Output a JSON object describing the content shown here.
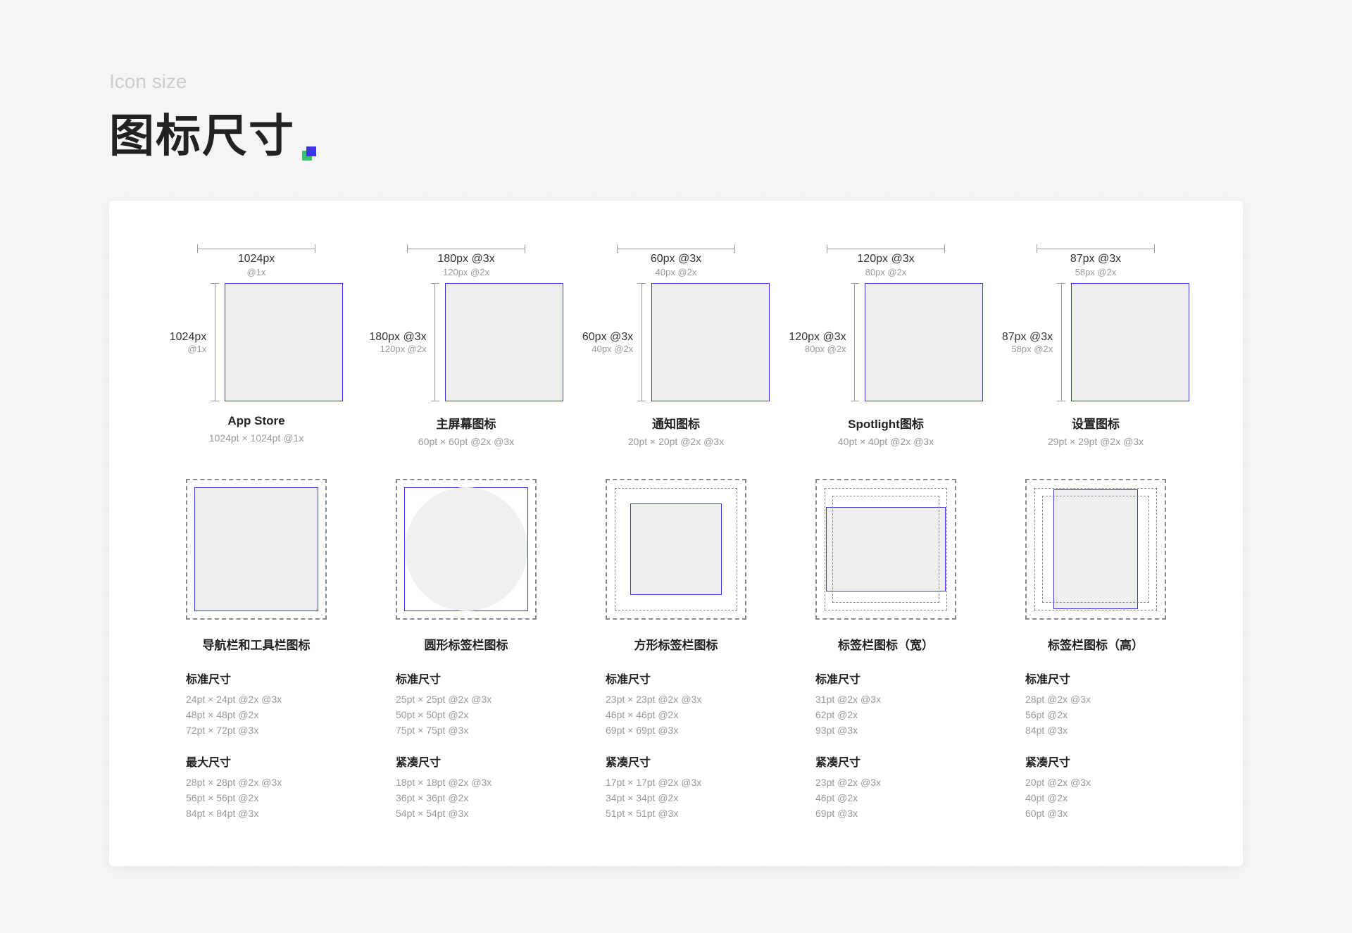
{
  "header": {
    "subtitle": "Icon size",
    "title": "图标尺寸"
  },
  "row1": [
    {
      "topLabel": "1024px",
      "topSub": "@1x",
      "leftLabel": "1024px",
      "leftSub": "@1x",
      "name": "App Store",
      "desc": "1024pt × 1024pt  @1x"
    },
    {
      "topLabel": "180px @3x",
      "topSub": "120px @2x",
      "leftLabel": "180px @3x",
      "leftSub": "120px @2x",
      "name": "主屏幕图标",
      "desc": "60pt × 60pt  @2x @3x"
    },
    {
      "topLabel": "60px @3x",
      "topSub": "40px @2x",
      "leftLabel": "60px @3x",
      "leftSub": "40px @2x",
      "name": "通知图标",
      "desc": "20pt × 20pt  @2x @3x"
    },
    {
      "topLabel": "120px @3x",
      "topSub": "80px @2x",
      "leftLabel": "120px @3x",
      "leftSub": "80px @2x",
      "name": "Spotlight图标",
      "desc": "40pt × 40pt  @2x @3x"
    },
    {
      "topLabel": "87px @3x",
      "topSub": "58px @2x",
      "leftLabel": "87px @3x",
      "leftSub": "58px @2x",
      "name": "设置图标",
      "desc": "29pt × 29pt  @2x @3x"
    }
  ],
  "row2": [
    {
      "shape": "full",
      "name": "导航栏和工具栏图标",
      "section1": {
        "label": "标准尺寸",
        "lines": [
          "24pt × 24pt  @2x @3x",
          "48pt × 48pt  @2x",
          "72pt × 72pt  @3x"
        ]
      },
      "section2": {
        "label": "最大尺寸",
        "lines": [
          "28pt × 28pt  @2x @3x",
          "56pt × 56pt  @2x",
          "84pt × 84pt  @3x"
        ]
      }
    },
    {
      "shape": "circle",
      "name": "圆形标签栏图标",
      "section1": {
        "label": "标准尺寸",
        "lines": [
          "25pt × 25pt  @2x @3x",
          "50pt × 50pt  @2x",
          "75pt × 75pt  @3x"
        ]
      },
      "section2": {
        "label": "紧凑尺寸",
        "lines": [
          "18pt × 18pt  @2x @3x",
          "36pt × 36pt  @2x",
          "54pt × 54pt  @3x"
        ]
      }
    },
    {
      "shape": "square",
      "name": "方形标签栏图标",
      "section1": {
        "label": "标准尺寸",
        "lines": [
          "23pt × 23pt  @2x @3x",
          "46pt × 46pt  @2x",
          "69pt × 69pt  @3x"
        ]
      },
      "section2": {
        "label": "紧凑尺寸",
        "lines": [
          "17pt × 17pt  @2x @3x",
          "34pt × 34pt  @2x",
          "51pt × 51pt  @3x"
        ]
      }
    },
    {
      "shape": "wide",
      "name": "标签栏图标（宽）",
      "section1": {
        "label": "标准尺寸",
        "lines": [
          "31pt  @2x @3x",
          "62pt  @2x",
          "93pt  @3x"
        ]
      },
      "section2": {
        "label": "紧凑尺寸",
        "lines": [
          "23pt  @2x @3x",
          "46pt  @2x",
          "69pt  @3x"
        ]
      }
    },
    {
      "shape": "tall",
      "name": "标签栏图标（高）",
      "section1": {
        "label": "标准尺寸",
        "lines": [
          "28pt  @2x @3x",
          "56pt  @2x",
          "84pt  @3x"
        ]
      },
      "section2": {
        "label": "紧凑尺寸",
        "lines": [
          "20pt  @2x @3x",
          "40pt  @2x",
          "60pt  @3x"
        ]
      }
    }
  ]
}
